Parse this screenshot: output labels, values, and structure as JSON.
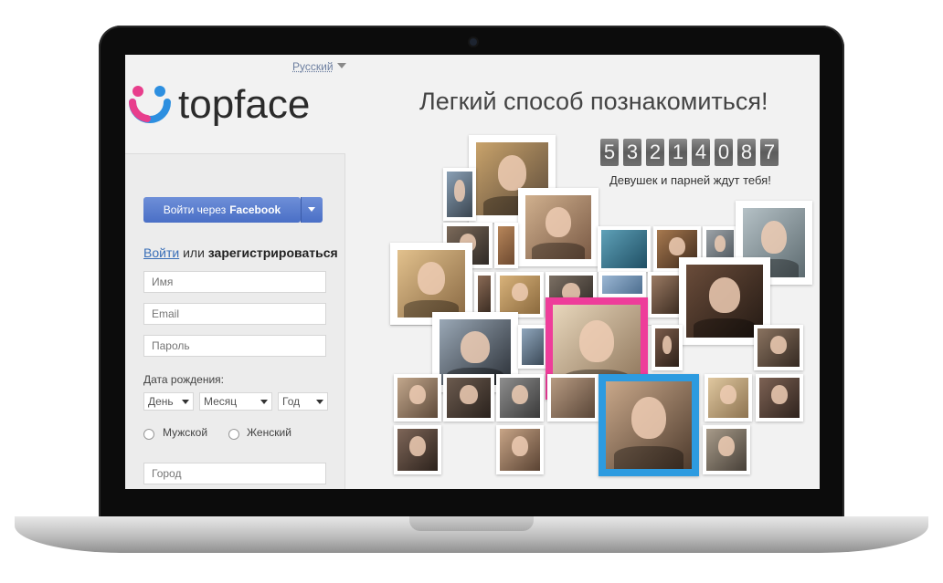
{
  "language": {
    "selected": "Русский"
  },
  "brand": {
    "name": "topface"
  },
  "headline": "Легкий способ познакомиться!",
  "counter": {
    "digits": [
      "5",
      "3",
      "2",
      "1",
      "4",
      "0",
      "8",
      "7"
    ],
    "caption": "Девушек и парней ждут тебя!"
  },
  "login": {
    "facebook_prefix": "Войти через",
    "facebook_brand": "Facebook",
    "login_link": "Войти",
    "or": "или",
    "register": "зарегистрироваться"
  },
  "form": {
    "name_placeholder": "Имя",
    "email_placeholder": "Email",
    "password_placeholder": "Пароль",
    "dob_label": "Дата рождения:",
    "day": "День",
    "month": "Месяц",
    "year": "Год",
    "gender_male": "Мужской",
    "gender_female": "Женский",
    "city_placeholder": "Город"
  },
  "colors": {
    "accent_blue": "#4a6fc6",
    "logo_blue": "#2d8fe0",
    "logo_pink": "#e83e8c",
    "highlight_pink": "#ee3d9a",
    "highlight_blue": "#2d9be0"
  }
}
